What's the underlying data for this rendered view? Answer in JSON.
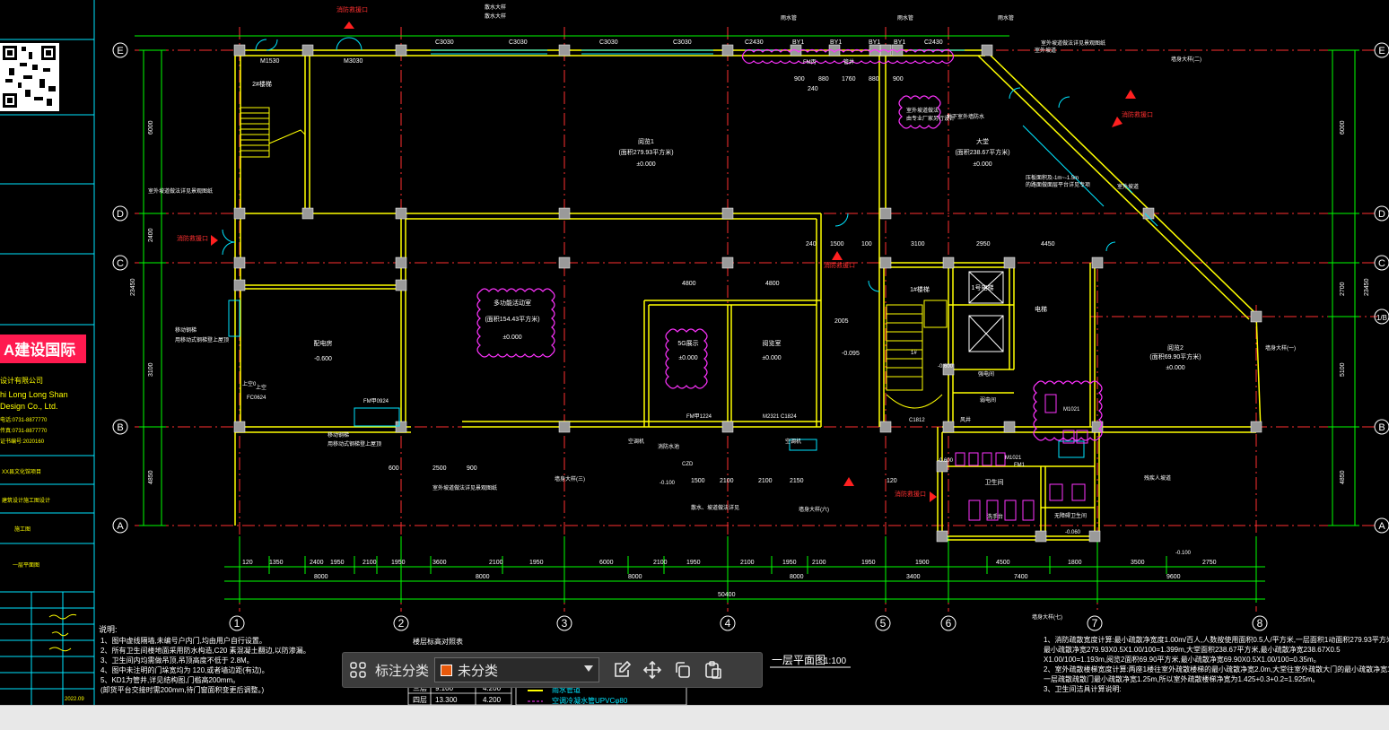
{
  "toolbar": {
    "grid_icon": "grid-apps-icon",
    "label": "标注分类",
    "select_value": "未分类",
    "select_color": "#e8590c",
    "icons": [
      "edit-icon",
      "move-icon",
      "copy-icon",
      "paste-icon"
    ]
  },
  "drawing": {
    "title": "一层平面图",
    "scale": "1:100",
    "total_dimension": "50400",
    "grid_columns": [
      "1",
      "2",
      "3",
      "4",
      "5",
      "6",
      "7",
      "8"
    ],
    "grid_rows_left": [
      "E",
      "D",
      "C",
      "B",
      "A"
    ],
    "grid_rows_right": [
      "E",
      "D",
      "C",
      "1/B",
      "B",
      "A"
    ],
    "rooms": [
      {
        "name": "阅览1",
        "area": "(面积279.93平方米)",
        "level": "±0.000"
      },
      {
        "name": "大堂",
        "area": "(面积238.67平方米)",
        "level": "±0.000"
      },
      {
        "name": "多功能活动室",
        "area": "(面积154.43平方米)",
        "level": "±0.000"
      },
      {
        "name": "5G展示",
        "level": "±0.000"
      },
      {
        "name": "阅览室",
        "level": "±0.000"
      },
      {
        "name": "配电房",
        "level": "-0.600"
      },
      {
        "name": "阅览2",
        "area": "(面积69.90平方米)",
        "level": "±0.000"
      },
      {
        "name": "卫生间"
      },
      {
        "name": "电梯",
        "tag": "1号电梯"
      },
      {
        "name": "2#楼梯"
      },
      {
        "name": "1#楼梯"
      }
    ],
    "notes_heading": "说明:",
    "notes": [
      "1、图中虚线隔墙,未编号户内门,均由用户自行设置。",
      "2、所有卫生间楼地面采用防水构造,C20 素混凝土翻边,以防渗漏。",
      "3、卫生间内均需做吊顶,吊顶高度不低于 2.8M。",
      "4、图中未注明的门垛宽均为 120,或者墙边距(有边)。",
      "5、KD1为管井,详见结构图,门槛高200mm。",
      "(卸货平台交接时需200mm,待门窗面积变更后调整。)"
    ],
    "right_notes": [
      "1、消防疏散宽度计算:最小疏散净宽度1.00m/百人,人数按使用面积0.5人/平方米,一层面积1动面积279.93平方米,",
      "最小疏散净宽279.93X0.5X1.00/100=1.399m,大堂面积238.67平方米,最小疏散净宽238.67X0.5",
      "X1.00/100=1.193m,阅览2面积69.90平方米,最小疏散净宽69.90X0.5X1.00/100=0.35m。",
      "2、室外疏散楼梯宽度计算:两座1楼往室外疏散楼梯的最小疏散净宽2.0m,大堂往室外疏散大门的最小疏散净宽1.2m,",
      "一层疏散疏散门最小疏散净宽1.25m,所以室外疏散楼梯净宽为1.425+0.3+0.2=1.925m。",
      "3、卫生间洁具计算说明:"
    ],
    "legend_title": "楼层标高对照表",
    "legend_rows": [
      [
        "三层",
        "9.100",
        "4.200"
      ],
      [
        "四层",
        "13.300",
        "4.200"
      ]
    ],
    "legend_items": [
      "雨水管道",
      "空调冷凝水管UPVCφ80"
    ],
    "sidebar": {
      "company_logo": "A建设国际",
      "company_cn": "设计有限公司",
      "company_en1": "hi Long Long Shan",
      "company_en2": "Design Co., Ltd.",
      "date": "2022.09",
      "sheet": "一层平面图"
    }
  }
}
